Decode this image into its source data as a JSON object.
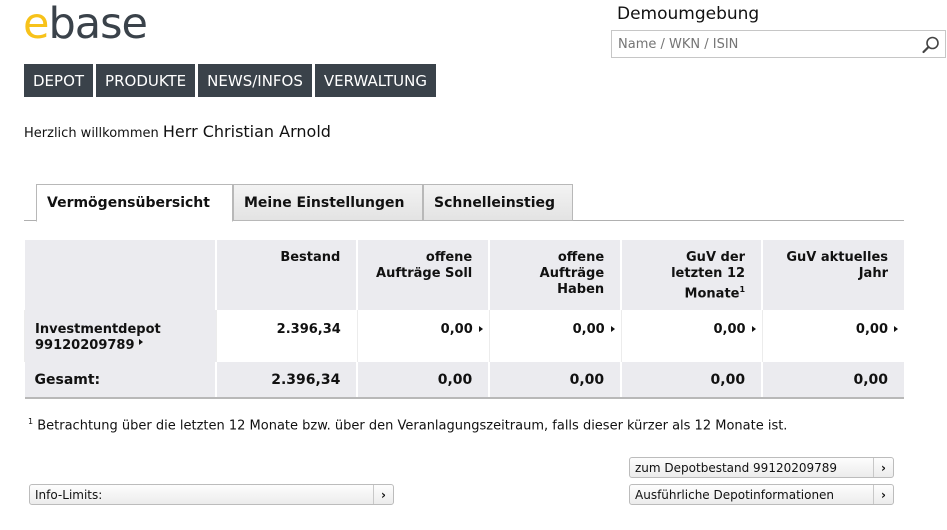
{
  "logo": {
    "accent_letter": "e",
    "rest": "base",
    "accent_color": "#f7c21a",
    "text_color": "#3a424a"
  },
  "header": {
    "environment": "Demoumgebung",
    "search": {
      "placeholder": "Name / WKN / ISIN",
      "value": "",
      "icon": "search-icon"
    }
  },
  "nav": {
    "items": [
      {
        "label": "DEPOT"
      },
      {
        "label": "PRODUKTE"
      },
      {
        "label": "NEWS/INFOS"
      },
      {
        "label": "VERWALTUNG"
      }
    ]
  },
  "welcome": {
    "greeting": "Herzlich willkommen",
    "name": "Herr Christian Arnold"
  },
  "tabs": [
    {
      "label": "Vermögensübersicht",
      "active": true
    },
    {
      "label": "Meine Einstellungen",
      "active": false
    },
    {
      "label": "Schnelleinstieg",
      "active": false
    }
  ],
  "table": {
    "headers": [
      {
        "line1": "",
        "line2": "",
        "line3": ""
      },
      {
        "line1": "Bestand",
        "line2": "",
        "line3": ""
      },
      {
        "line1": "offene",
        "line2": "Aufträge Soll",
        "line3": ""
      },
      {
        "line1": "offene",
        "line2": "Aufträge",
        "line3": "Haben"
      },
      {
        "line1": "GuV der",
        "line2": "letzten 12",
        "line3": "Monate",
        "sup": "1"
      },
      {
        "line1": "GuV aktuelles",
        "line2": "Jahr",
        "line3": ""
      }
    ],
    "rows": [
      {
        "label_line1": "Investmentdepot",
        "label_line2": "99120209789",
        "bestand": "2.396,34",
        "soll": "0,00",
        "haben": "0,00",
        "guv12": "0,00",
        "guvjahr": "0,00"
      }
    ],
    "total": {
      "label": "Gesamt:",
      "bestand": "2.396,34",
      "soll": "0,00",
      "haben": "0,00",
      "guv12": "0,00",
      "guvjahr": "0,00"
    }
  },
  "footnote": {
    "marker": "1",
    "text": " Betrachtung über die letzten 12 Monate bzw. über den Veranlagungszeitraum, falls dieser kürzer als 12 Monate ist."
  },
  "buttons": {
    "depotbestand": "zum Depotbestand 99120209789",
    "depotinfo": "Ausführliche Depotinformationen",
    "info_limits": "Info-Limits:",
    "chevron": "›"
  }
}
